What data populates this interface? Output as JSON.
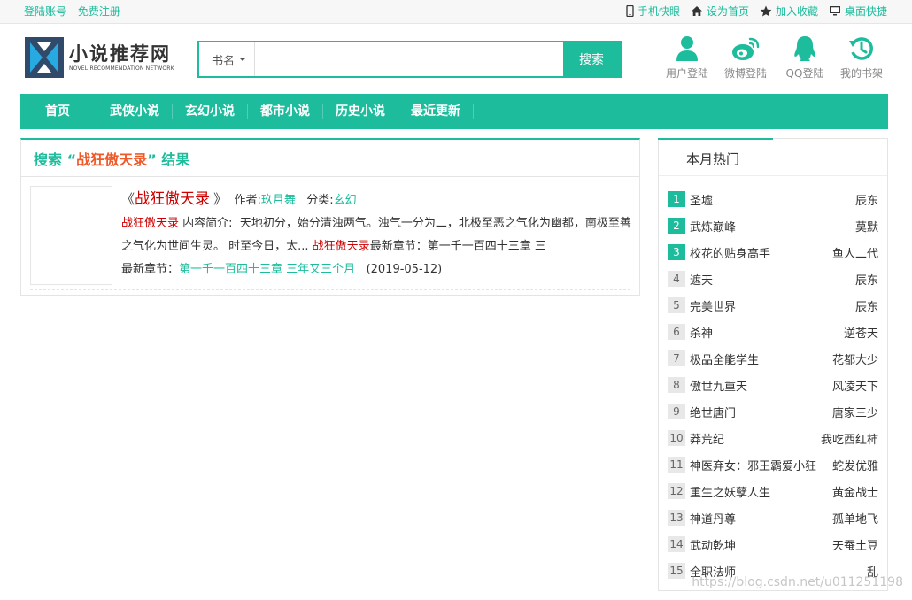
{
  "topbar": {
    "login": "登陆账号",
    "register": "免费注册",
    "links": [
      {
        "icon": "mobile-icon",
        "label": "手机快眼"
      },
      {
        "icon": "home-icon",
        "label": "设为首页"
      },
      {
        "icon": "star-icon",
        "label": "加入收藏"
      },
      {
        "icon": "monitor-icon",
        "label": "桌面快捷"
      }
    ]
  },
  "logo": {
    "cn": "小说推荐网",
    "en": "NOVEL RECOMMENDATION NETWORK"
  },
  "search": {
    "type_selected": "书名",
    "input_value": "",
    "button": "搜索"
  },
  "quick": [
    {
      "icon": "user-icon",
      "label": "用户登陆"
    },
    {
      "icon": "weibo-icon",
      "label": "微博登陆"
    },
    {
      "icon": "qq-icon",
      "label": "QQ登陆"
    },
    {
      "icon": "bookshelf-icon",
      "label": "我的书架"
    }
  ],
  "nav": [
    "首页",
    "武侠小说",
    "玄幻小说",
    "都市小说",
    "历史小说",
    "最近更新"
  ],
  "result": {
    "title_prefix": "搜索 “",
    "keyword": "战狂傲天录",
    "title_suffix": "” 结果",
    "book": {
      "open_quote": "《",
      "title": "战狂傲天录",
      "close_quote": "》",
      "author_label": "作者:",
      "author": "玖月舞",
      "category_label": "分类:",
      "category": "玄幻",
      "desc_title": "战狂傲天录",
      "desc_label": "内容简介:",
      "desc_text": "天地初分，始分清浊两气。浊气一分为二，北极至恶之气化为幽都，南极至善之气化为世间生灵。 时至今日，太...",
      "desc_title2": "战狂傲天录",
      "latest_inline": "最新章节：第一千一百四十三章 三",
      "latest_label": "最新章节：",
      "latest": "第一千一百四十三章 三年又三个月",
      "date": "(2019-05-12)"
    }
  },
  "hot": {
    "title": "本月热门",
    "items": [
      {
        "rank": "1",
        "name": "圣墟",
        "author": "辰东"
      },
      {
        "rank": "2",
        "name": "武炼巅峰",
        "author": "莫默"
      },
      {
        "rank": "3",
        "name": "校花的贴身高手",
        "author": "鱼人二代"
      },
      {
        "rank": "4",
        "name": "遮天",
        "author": "辰东"
      },
      {
        "rank": "5",
        "name": "完美世界",
        "author": "辰东"
      },
      {
        "rank": "6",
        "name": "杀神",
        "author": "逆苍天"
      },
      {
        "rank": "7",
        "name": "极品全能学生",
        "author": "花都大少"
      },
      {
        "rank": "8",
        "name": "傲世九重天",
        "author": "风凌天下"
      },
      {
        "rank": "9",
        "name": "绝世唐门",
        "author": "唐家三少"
      },
      {
        "rank": "10",
        "name": "莽荒纪",
        "author": "我吃西红柿"
      },
      {
        "rank": "11",
        "name": "神医弃女：邪王霸爱小狂",
        "author": "蛇发优雅"
      },
      {
        "rank": "12",
        "name": "重生之妖孽人生",
        "author": "黄金战士"
      },
      {
        "rank": "13",
        "name": "神道丹尊",
        "author": "孤单地飞"
      },
      {
        "rank": "14",
        "name": "武动乾坤",
        "author": "天蚕土豆"
      },
      {
        "rank": "15",
        "name": "全职法师",
        "author": "乱"
      }
    ]
  },
  "watermark": "https://blog.csdn.net/u011251198",
  "colors": {
    "accent": "#1cbc9c",
    "highlight": "#cc0000",
    "keyword": "#f05a28"
  }
}
